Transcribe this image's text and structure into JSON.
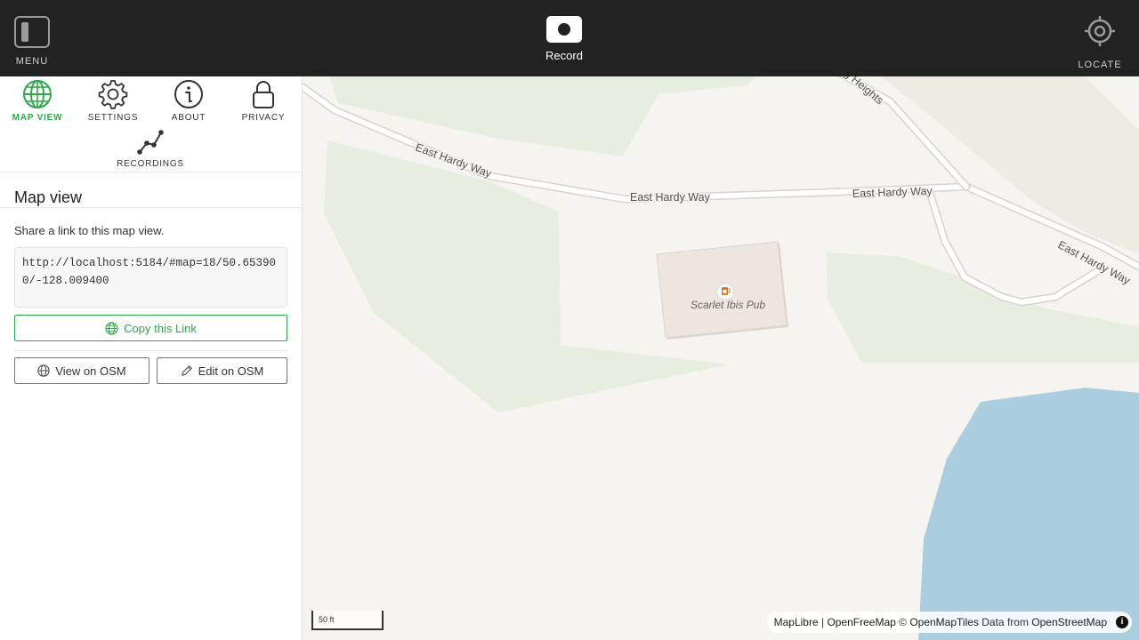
{
  "topbar": {
    "menu_label": "MENU",
    "record_label": "Record",
    "locate_label": "LOCATE"
  },
  "sidebar": {
    "tabs": [
      {
        "label": "MAP VIEW",
        "icon": "globe-icon",
        "active": true
      },
      {
        "label": "SETTINGS",
        "icon": "gear-icon"
      },
      {
        "label": "ABOUT",
        "icon": "info-icon"
      },
      {
        "label": "PRIVACY",
        "icon": "lock-icon"
      },
      {
        "label": "RECORDINGS",
        "icon": "route-icon"
      }
    ],
    "panel_title": "Map view",
    "description": "Share a link to this map view.",
    "link": "http://localhost:5184/#map=18/50.653900/-128.009400",
    "copy_label": "Copy this Link",
    "view_osm_label": "View on OSM",
    "edit_osm_label": "Edit on OSM"
  },
  "map": {
    "labels": {
      "road_1": "East Hardy Way",
      "road_2": "East Hardy Way",
      "road_3": "East Hardy Way",
      "road_4": "East Hardy Way",
      "road_5": "g Heights",
      "poi": "Scarlet Ibis Pub"
    },
    "scale_label": "50 ft",
    "attribution": {
      "maplibre": "MapLibre",
      "sep": " | ",
      "openfreemap": "OpenFreeMap",
      "copy": " © ",
      "openmaptiles": "OpenMapTiles",
      "data_from": " Data from ",
      "osm": "OpenStreetMap"
    },
    "colors": {
      "land": "#f6f4f0",
      "park": "#e8ede1",
      "water": "#aacde0",
      "road": "#ffffff",
      "road_casing": "#d6d3cf",
      "building": "#ede5df",
      "poi_icon": "#e07a14"
    }
  },
  "accent_color": "#2fa84a"
}
